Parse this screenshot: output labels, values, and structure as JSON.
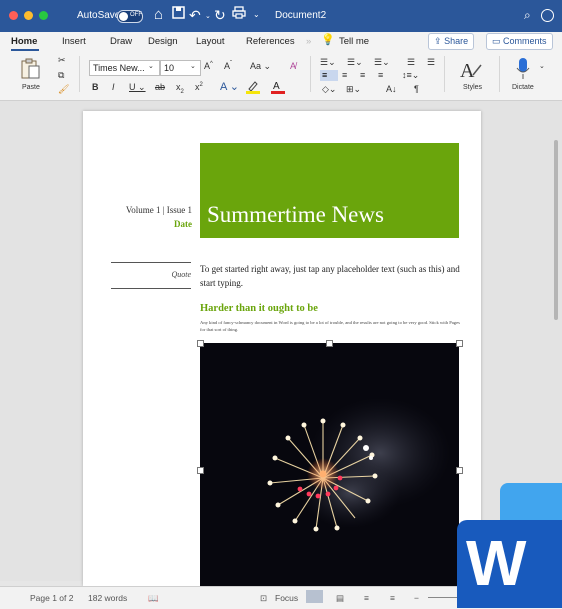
{
  "window": {
    "autosave_label": "AutoSave",
    "autosave_state": "OFF",
    "doc_title": "Document2",
    "title_bar_color": "#2b579a"
  },
  "ribbon": {
    "tabs": [
      "Home",
      "Insert",
      "Draw",
      "Design",
      "Layout",
      "References",
      "Tell me"
    ],
    "share_label": "Share",
    "comments_label": "Comments",
    "paste_label": "Paste",
    "font_name": "Times New...",
    "font_size": "10",
    "styles_label": "Styles",
    "dictate_label": "Dictate"
  },
  "document": {
    "volume_issue": "Volume 1 | Issue 1",
    "date_label": "Date",
    "newsletter_title": "Summertime News",
    "quote_placeholder": "Quote",
    "intro_text": "To get started right away, just tap any placeholder text (such as this) and start typing.",
    "heading": "Harder than it ought to be",
    "body_small": "Any kind of fancy-schmancy document in Word is going to be a lot of trouble, and the results are not going to be very good. Stick with Pages for that sort of thing.",
    "accent_color": "#6aa50c"
  },
  "status": {
    "page_info": "Page 1 of 2",
    "word_count": "182 words",
    "focus_label": "Focus"
  }
}
